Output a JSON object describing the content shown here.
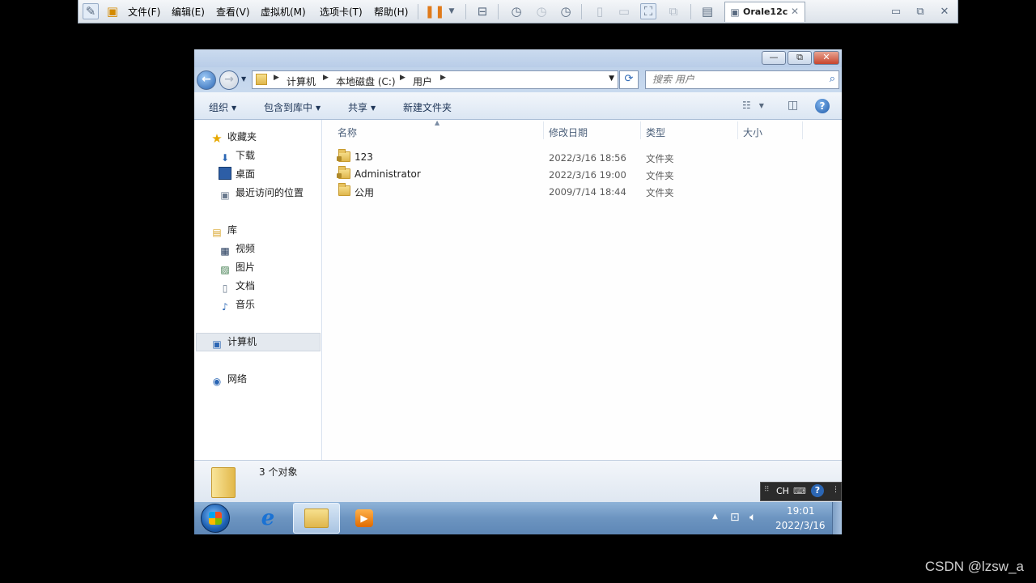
{
  "host": {
    "menus": [
      "文件(F)",
      "编辑(E)",
      "查看(V)",
      "虚拟机(M)",
      "选项卡(T)",
      "帮助(H)"
    ],
    "tab_title": "Orale12c",
    "tab_close": "✕",
    "window_controls": [
      "▭",
      "⧉",
      "✕"
    ]
  },
  "window": {
    "caption_buttons": [
      "—",
      "⧉",
      "✕"
    ],
    "breadcrumbs": [
      "计算机",
      "本地磁盘 (C:)",
      "用户"
    ],
    "search_placeholder": "搜索 用户",
    "toolbar": {
      "organize": "组织",
      "include_in_library": "包含到库中",
      "share": "共享",
      "new_folder": "新建文件夹"
    },
    "nav": {
      "favorites": "收藏夹",
      "downloads": "下载",
      "desktop": "桌面",
      "recent": "最近访问的位置",
      "libraries": "库",
      "videos": "视频",
      "pictures": "图片",
      "documents": "文档",
      "music": "音乐",
      "computer": "计算机",
      "network": "网络"
    },
    "columns": {
      "name": "名称",
      "modified": "修改日期",
      "type": "类型",
      "size": "大小"
    },
    "files": [
      {
        "name": "123",
        "modified": "2022/3/16 18:56",
        "type": "文件夹"
      },
      {
        "name": "Administrator",
        "modified": "2022/3/16 19:00",
        "type": "文件夹"
      },
      {
        "name": "公用",
        "modified": "2009/7/14 18:44",
        "type": "文件夹"
      }
    ],
    "status": "3 个对象"
  },
  "taskbar": {
    "time": "19:01",
    "date": "2022/3/16",
    "language": "CH"
  },
  "watermark": "CSDN @lzsw_a",
  "icons": {
    "host": [
      "pin-icon",
      "vm-logo-icon",
      "pause-icon",
      "snapshot-icon",
      "fullscreen-icon"
    ],
    "accent": "#2b66b4"
  }
}
